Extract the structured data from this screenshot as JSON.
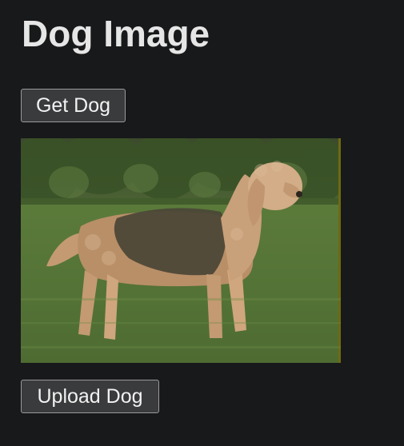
{
  "page": {
    "title": "Dog Image"
  },
  "buttons": {
    "get_dog": "Get Dog",
    "upload_dog": "Upload Dog"
  },
  "image": {
    "subject": "dog standing on grass",
    "colors": {
      "background": "#18191b",
      "grass": "#5c7a3c",
      "trees": "#3f5a2c",
      "dog_fur": "#c9a27a",
      "dog_dark": "#4a4638"
    }
  }
}
